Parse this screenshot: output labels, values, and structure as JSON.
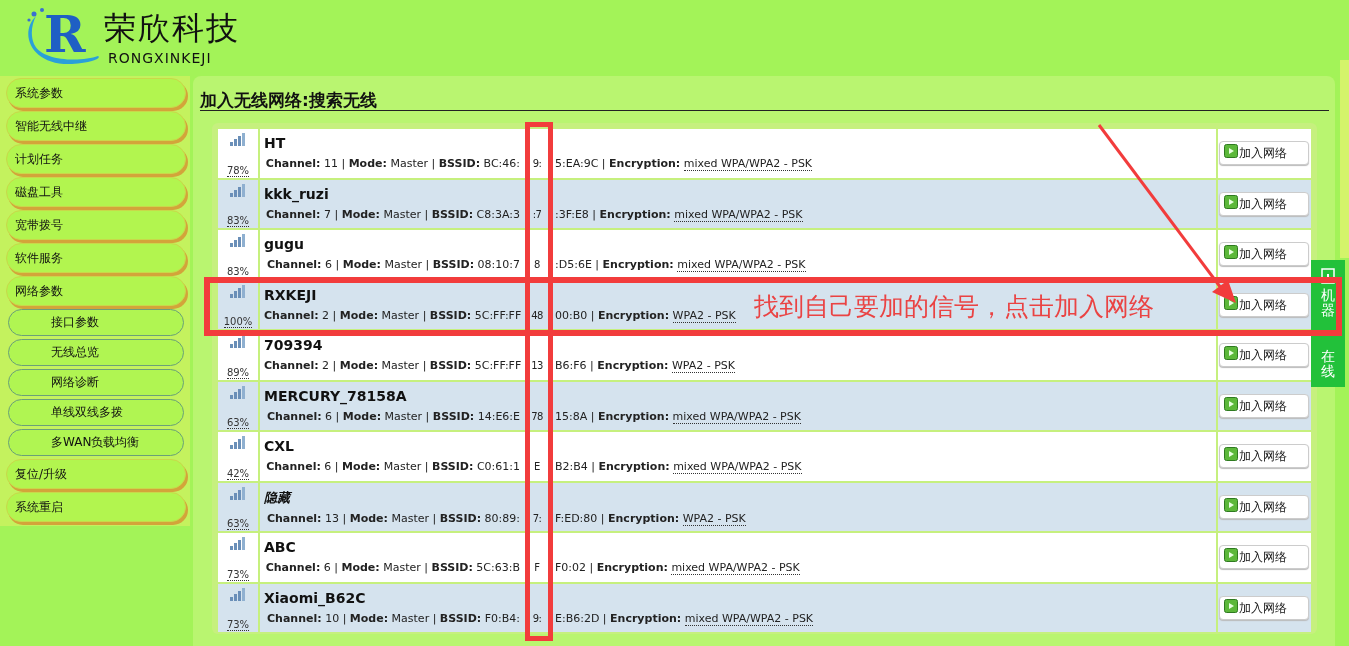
{
  "logo": {
    "mark": "R",
    "name": "荣欣科技",
    "subtitle": "RONGXINKEJI"
  },
  "sidebar": {
    "items": [
      {
        "label": "系统参数"
      },
      {
        "label": "智能无线中继"
      },
      {
        "label": "计划任务"
      },
      {
        "label": "磁盘工具"
      },
      {
        "label": "宽带拨号"
      },
      {
        "label": "软件服务"
      },
      {
        "label": "网络参数",
        "children": [
          {
            "label": "接口参数"
          },
          {
            "label": "无线总览"
          },
          {
            "label": "网络诊断"
          },
          {
            "label": "单线双线多拨"
          },
          {
            "label": "多WAN负载均衡"
          }
        ]
      },
      {
        "label": "复位/升级"
      },
      {
        "label": "系统重启"
      }
    ]
  },
  "page_title": "加入无线网络:搜索无线",
  "networks": [
    {
      "ssid": "HT",
      "hidden": false,
      "percent": "78%",
      "details_left": "**Channel:** 11 | **Mode:** Master | **BSSID:** BC:46:",
      "details_middle": "9:",
      "details_right": "5:EA:9C | **Encryption:**",
      "encryption": "mixed WPA/WPA2 - PSK",
      "button": "加入网络"
    },
    {
      "ssid": "kkk_ruzi",
      "hidden": false,
      "percent": "83%",
      "details_left": "**Channel:** 7 | **Mode:** Master | **BSSID:** C8:3A:3",
      "details_middle": ":7",
      "details_right": ":3F:E8 | **Encryption:**",
      "encryption": "mixed WPA/WPA2 - PSK",
      "button": "加入网络"
    },
    {
      "ssid": "gugu",
      "hidden": false,
      "percent": "83%",
      "details_left": "**Channel:** 6 | **Mode:** Master | **BSSID:** 08:10:7",
      "details_middle": "8",
      "details_right": ":D5:6E | **Encryption:**",
      "encryption": "mixed WPA/WPA2 - PSK",
      "button": "加入网络"
    },
    {
      "ssid": "RXKEJI",
      "hidden": false,
      "percent": "100%",
      "details_left": "**Channel:** 2 | **Mode:** Master | **BSSID:** 5C:FF:FF",
      "details_middle": "48",
      "details_right": "00:B0 | **Encryption:**",
      "encryption": "WPA2 - PSK",
      "button": "加入网络"
    },
    {
      "ssid": "709394",
      "hidden": false,
      "percent": "89%",
      "details_left": "**Channel:** 2 | **Mode:** Master | **BSSID:** 5C:FF:FF",
      "details_middle": "13",
      "details_right": "B6:F6 | **Encryption:**",
      "encryption": "WPA2 - PSK",
      "button": "加入网络"
    },
    {
      "ssid": "MERCURY_78158A",
      "hidden": false,
      "percent": "63%",
      "details_left": "**Channel:** 6 | **Mode:** Master | **BSSID:** 14:E6:E",
      "details_middle": "78",
      "details_right": "15:8A | **Encryption:**",
      "encryption": "mixed WPA/WPA2 - PSK",
      "button": "加入网络"
    },
    {
      "ssid": "CXL",
      "hidden": false,
      "percent": "42%",
      "details_left": "**Channel:** 6 | **Mode:** Master | **BSSID:** C0:61:1",
      "details_middle": "E",
      "details_right": "B2:B4 | **Encryption:**",
      "encryption": "mixed WPA/WPA2 - PSK",
      "button": "加入网络"
    },
    {
      "ssid": "隐藏",
      "hidden": true,
      "percent": "63%",
      "details_left": "**Channel:** 13 | **Mode:** Master | **BSSID:** 80:89:",
      "details_middle": "7:",
      "details_right": "F:ED:80 | **Encryption:**",
      "encryption": "WPA2 - PSK",
      "button": "加入网络"
    },
    {
      "ssid": "ABC",
      "hidden": false,
      "percent": "73%",
      "details_left": "**Channel:** 6 | **Mode:** Master | **BSSID:** 5C:63:B",
      "details_middle": "F",
      "details_right": "F0:02 | **Encryption:**",
      "encryption": "mixed WPA/WPA2 - PSK",
      "button": "加入网络"
    },
    {
      "ssid": "Xiaomi_B62C",
      "hidden": false,
      "percent": "73%",
      "details_left": "**Channel:** 10 | **Mode:** Master | **BSSID:** F0:B4:",
      "details_middle": "9:",
      "details_right": "E:B6:2D | **Encryption:**",
      "encryption": "mixed WPA/WPA2 - PSK",
      "button": "加入网络"
    }
  ],
  "side_tab": {
    "label_top": "机器",
    "label_bottom": "在线"
  },
  "annotation": {
    "text": "找到自己要加的信号，点击加入网络"
  }
}
